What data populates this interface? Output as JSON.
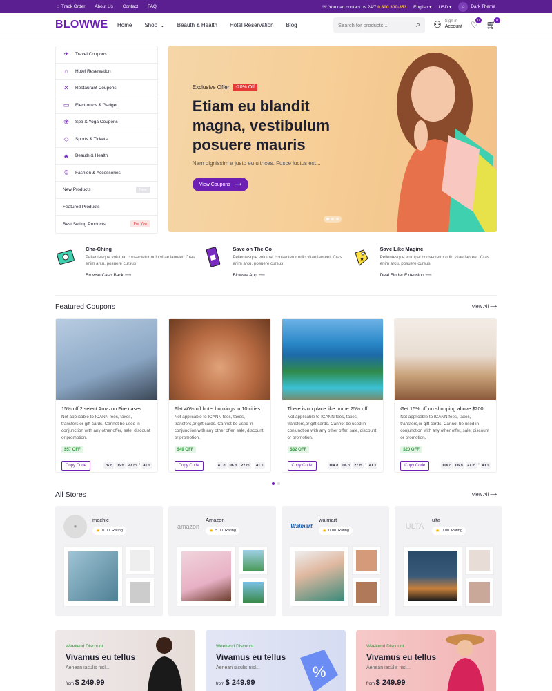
{
  "topbar": {
    "links": [
      "Track Order",
      "About Us",
      "Contact",
      "FAQ"
    ],
    "contact_label": "You can contact us 24/7",
    "phone": "0 800 300-353",
    "language": "English",
    "currency": "USD",
    "theme_label": "Dark Theme"
  },
  "header": {
    "logo": "BLOWWE",
    "nav": [
      "Home",
      "Shop",
      "Beauth & Health",
      "Hotel Reservation",
      "Blog"
    ],
    "search_placeholder": "Search for products...",
    "signin_label": "Sign in",
    "account_label": "Account",
    "wishlist_count": "0",
    "cart_count": "0"
  },
  "sidebar": {
    "items": [
      {
        "label": "Travel Coupons",
        "icon": "plane-icon"
      },
      {
        "label": "Hotel Reservation",
        "icon": "hotel-icon"
      },
      {
        "label": "Restaurant Coupons",
        "icon": "cutlery-icon"
      },
      {
        "label": "Electronics & Gadget",
        "icon": "monitor-icon"
      },
      {
        "label": "Spa & Yoga Coupons",
        "icon": "spa-icon"
      },
      {
        "label": "Sports & Tickets",
        "icon": "ticket-icon"
      },
      {
        "label": "Beauth & Health",
        "icon": "beauty-icon"
      },
      {
        "label": "Fashion & Accessories",
        "icon": "watch-icon"
      },
      {
        "label": "New Products",
        "tag": "New"
      },
      {
        "label": "Featured Products"
      },
      {
        "label": "Best Selling Products",
        "tag": "For You"
      }
    ]
  },
  "hero": {
    "eyebrow": "Exclusive Offer",
    "discount": "-20% Off",
    "title": "Etiam eu blandit magna, vestibulum posuere mauris",
    "subtitle": "Nam dignissim a justo eu ultrices. Fusce luctus est...",
    "button": "View Coupons"
  },
  "features": [
    {
      "title": "Cha-Ching",
      "text": "Pellentesque volutpat consectetur odio vitae laoreet. Cras enim arcu, posuere cursus",
      "link": "Browse Cash Back"
    },
    {
      "title": "Save on The Go",
      "text": "Pellentesque volutpat consectetur odio vitae laoreet. Cras enim arcu, posuere cursus",
      "link": "Blowwe App"
    },
    {
      "title": "Save Like Maginc",
      "text": "Pellentesque volutpat consectetur odio vitae laoreet. Cras enim arcu, posuere cursus",
      "link": "Deal Finder Extension"
    }
  ],
  "featured": {
    "heading": "Featured Coupons",
    "view_all": "View All",
    "coupons": [
      {
        "title": "15% off 2 select Amazon Fire cases",
        "desc": "Not applicable to ICANN fees, taxes, transfers,or gift cards. Cannot be used in conjunction with any other offer, sale, discount or promotion.",
        "price": "$57 OFF",
        "copy": "Copy Code",
        "d": "76",
        "h": "06",
        "m": "27",
        "s": "41"
      },
      {
        "title": "Flat 40% off hotel bookings in 10 cities",
        "desc": "Not applicable to ICANN fees, taxes, transfers,or gift cards. Cannot be used in conjunction with any other offer, sale, discount or promotion.",
        "price": "$49 OFF",
        "copy": "Copy Code",
        "d": "41",
        "h": "06",
        "m": "27",
        "s": "41"
      },
      {
        "title": "There is no place like home 25% off",
        "desc": "Not applicable to ICANN fees, taxes, transfers,or gift cards. Cannot be used in conjunction with any other offer, sale, discount or promotion.",
        "price": "$32 OFF",
        "copy": "Copy Code",
        "d": "104",
        "h": "06",
        "m": "27",
        "s": "41"
      },
      {
        "title": "Get 15% off on shopping above $200",
        "desc": "Not applicable to ICANN fees, taxes, transfers,or gift cards. Cannot be used in conjunction with any other offer, sale, discount or promotion.",
        "price": "$20 OFF",
        "copy": "Copy Code",
        "d": "116",
        "h": "06",
        "m": "27",
        "s": "41"
      }
    ]
  },
  "stores": {
    "heading": "All Stores",
    "view_all": "View All",
    "items": [
      {
        "name": "machic",
        "rating": "0.00",
        "logo": ""
      },
      {
        "name": "Amazon",
        "rating": "5.00",
        "logo": "amazon"
      },
      {
        "name": "walmart",
        "rating": "0.00",
        "logo": "Walmart"
      },
      {
        "name": "ulta",
        "rating": "0.00",
        "logo": "ULTA"
      }
    ],
    "rating_label": "Rating"
  },
  "banners": [
    {
      "eyebrow": "Weekend Discount",
      "title": "Vivamus eu tellus",
      "sub": "Aenean iaculis nisl...",
      "from": "from",
      "price": "$ 249.99"
    },
    {
      "eyebrow": "Weekend Discount",
      "title": "Vivamus eu tellus",
      "sub": "Aenean iaculis nisl...",
      "from": "from",
      "price": "$ 249.99"
    },
    {
      "eyebrow": "Weekend Discount",
      "title": "Vivamus eu tellus",
      "sub": "Aenean iaculis nisl...",
      "from": "from",
      "price": "$ 249.99"
    }
  ],
  "colors": {
    "brand": "#6d1fb4",
    "topbar": "#5b1f92",
    "sale_red": "#e53935",
    "price_green": "#2e9a3b"
  }
}
